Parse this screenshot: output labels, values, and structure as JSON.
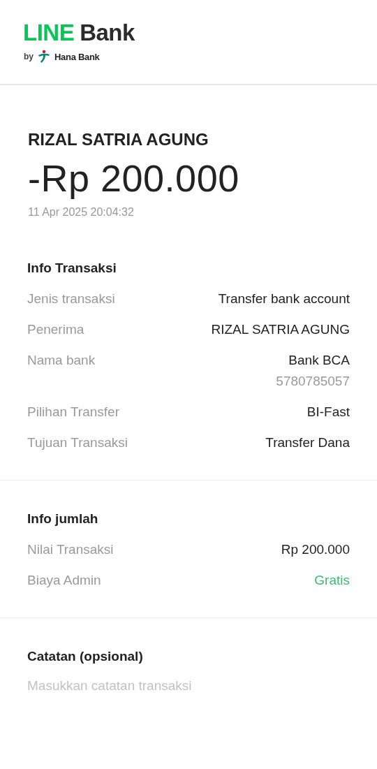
{
  "logo": {
    "brand_primary": "LINE",
    "brand_secondary": "Bank",
    "by": "by",
    "partner": "Hana Bank"
  },
  "transaction": {
    "name": "RIZAL SATRIA AGUNG",
    "amount": "-Rp 200.000",
    "datetime": "11 Apr 2025 20:04:32"
  },
  "sections": [
    {
      "title": "Info Transaksi",
      "rows": [
        {
          "label": "Jenis transaksi",
          "value": "Transfer bank account",
          "kind": "plain"
        },
        {
          "label": "Penerima",
          "value": "RIZAL SATRIA AGUNG",
          "kind": "plain"
        },
        {
          "label": "Nama bank",
          "value": "Bank BCA",
          "sub_value": "5780785057",
          "kind": "plain"
        },
        {
          "label": "Pilihan Transfer",
          "value": "BI-Fast",
          "kind": "plain"
        },
        {
          "label": "Tujuan Transaksi",
          "value": "Transfer Dana",
          "kind": "plain"
        }
      ]
    },
    {
      "title": "Info jumlah",
      "rows": [
        {
          "label": "Nilai Transaksi",
          "value": "Rp 200.000",
          "kind": "plain"
        },
        {
          "label": "Biaya Admin",
          "value": "Gratis",
          "kind": "accent"
        }
      ]
    }
  ],
  "note": {
    "title": "Catatan (opsional)",
    "placeholder": "Masukkan catatan transaksi"
  }
}
